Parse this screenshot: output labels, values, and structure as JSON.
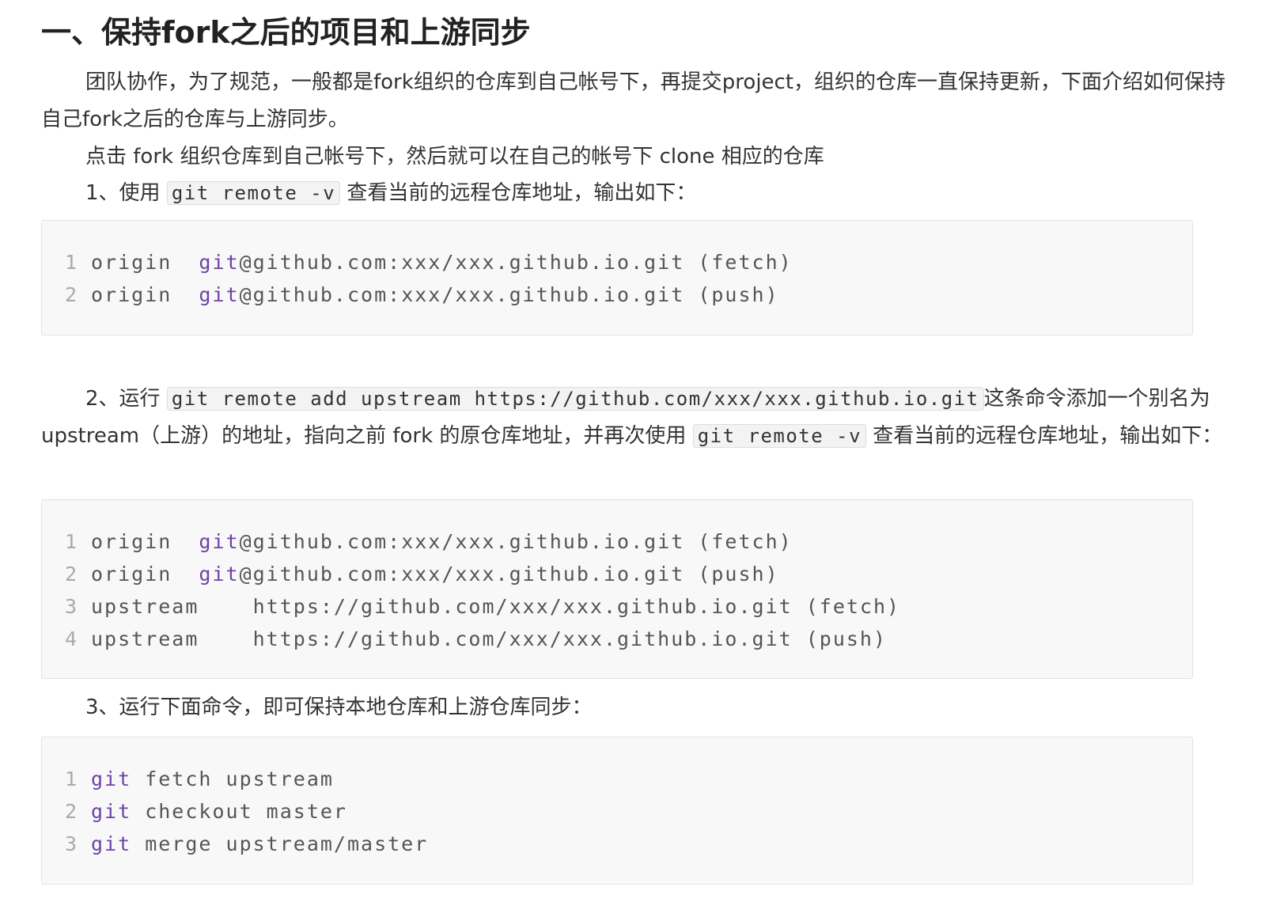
{
  "heading": "一、保持fork之后的项目和上游同步",
  "intro": {
    "text": "团队协作，为了规范，一般都是fork组织的仓库到自己帐号下，再提交project，组织的仓库一直保持更新，下面介绍如何保持自己fork之后的仓库与上游同步。"
  },
  "fork_note": "点击 fork 组织仓库到自己帐号下，然后就可以在自己的帐号下 clone 相应的仓库",
  "step1": {
    "prefix": "1、使用 ",
    "code": "git remote -v",
    "suffix": " 查看当前的远程仓库地址，输出如下："
  },
  "block1": [
    {
      "num": "1",
      "kw": "",
      "a": "origin  ",
      "b": "git",
      "c": "@github.com:xxx/xxx.github.io.git (fetch)"
    },
    {
      "num": "2",
      "kw": "",
      "a": "origin  ",
      "b": "git",
      "c": "@github.com:xxx/xxx.github.io.git (push)"
    }
  ],
  "step2": {
    "prefix": "2、运行 ",
    "code1": "git remote add upstream https://github.com/xxx/xxx.github.io.git",
    "middle": "这条命令添加一个别名为 upstream（上游）的地址，指向之前 fork 的原仓库地址，并再次使用 ",
    "code2": "git remote -v",
    "suffix": " 查看当前的远程仓库地址，输出如下："
  },
  "block2": [
    {
      "num": "1",
      "a": "origin  ",
      "b": "git",
      "c": "@github.com:xxx/xxx.github.io.git (fetch)"
    },
    {
      "num": "2",
      "a": "origin  ",
      "b": "git",
      "c": "@github.com:xxx/xxx.github.io.git (push)"
    },
    {
      "num": "3",
      "a": "upstream    https://github.com/xxx/xxx.github.io.git (fetch)",
      "b": "",
      "c": ""
    },
    {
      "num": "4",
      "a": "upstream    https://github.com/xxx/xxx.github.io.git (push)",
      "b": "",
      "c": ""
    }
  ],
  "step3": "3、运行下面命令，即可保持本地仓库和上游仓库同步：",
  "block3": [
    {
      "num": "1",
      "kw": "git",
      "rest": " fetch upstream"
    },
    {
      "num": "2",
      "kw": "git",
      "rest": " checkout master"
    },
    {
      "num": "3",
      "kw": "git",
      "rest": " merge upstream/master"
    }
  ],
  "colors": {
    "keyword": "#6f42a8",
    "line_number": "#aaaaaa",
    "code_bg": "#f8f8f8"
  }
}
